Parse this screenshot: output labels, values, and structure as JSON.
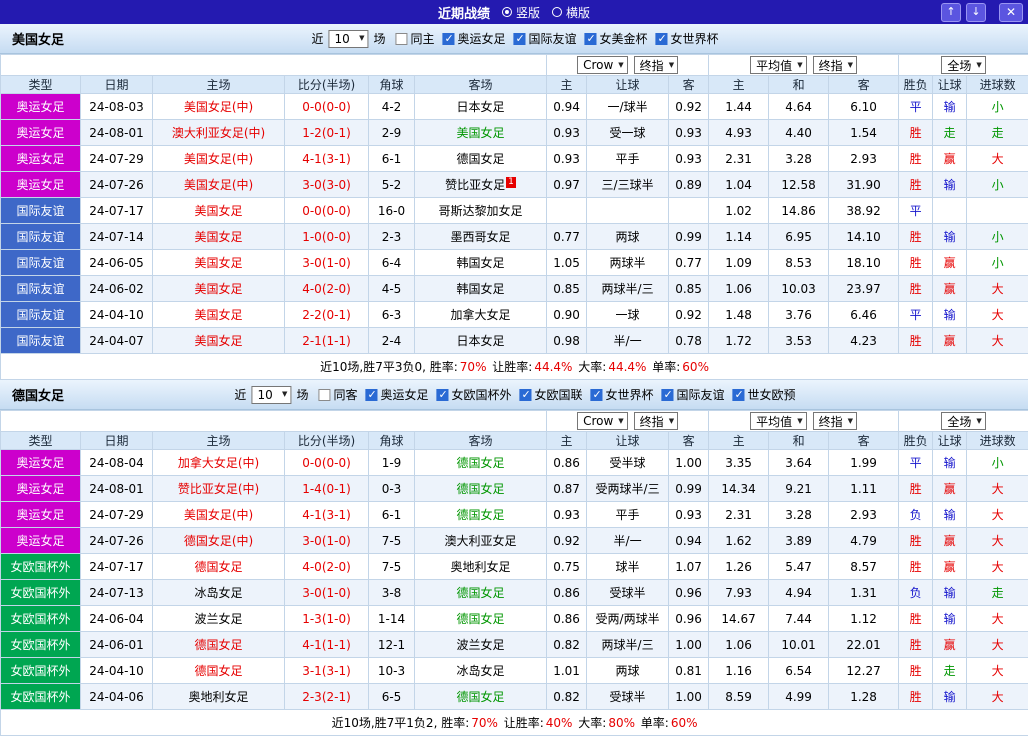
{
  "topbar": {
    "title": "近期战绩",
    "layout_options": [
      {
        "label": "竖版",
        "selected": true
      },
      {
        "label": "横版",
        "selected": false
      }
    ],
    "up_icon": "↑",
    "down_icon": "↓",
    "close_icon": "✕"
  },
  "palette": {
    "topbar_bg": "#241ab0",
    "header_bg": "#d8e8f8",
    "row_alt_bg": "#edf3fb",
    "red": "#e60000",
    "green": "#009600",
    "blue": "#1414cc"
  },
  "type_colors": {
    "奥运女足": "#cc00cc",
    "国际友谊": "#3e68c8",
    "女欧国杯外": "#00a651"
  },
  "columns": [
    "类型",
    "日期",
    "主场",
    "比分(半场)",
    "角球",
    "客场",
    "主",
    "让球",
    "客",
    "主",
    "和",
    "客",
    "胜负",
    "让球",
    "进球数"
  ],
  "sections": [
    {
      "team": "美国女足",
      "filters": {
        "near_label": "近",
        "count": "10",
        "unit_label": "场",
        "same_venue": {
          "label": "同主",
          "checked": false
        },
        "competitions": [
          {
            "label": "奥运女足",
            "checked": true
          },
          {
            "label": "国际友谊",
            "checked": true
          },
          {
            "label": "女美金杯",
            "checked": true
          },
          {
            "label": "女世界杯",
            "checked": true
          }
        ]
      },
      "selects": {
        "asian_source": "Crow",
        "asian_time": "终指",
        "euro_source": "平均值",
        "euro_time": "终指",
        "scope": "全场"
      },
      "rows": [
        {
          "type": "奥运女足",
          "date": "24-08-03",
          "home": "美国女足(中)",
          "home_color": "red",
          "score": "0-0(0-0)",
          "corner": "4-2",
          "away": "日本女足",
          "away_color": "black",
          "away_badge": "",
          "ah": [
            "0.94",
            "一/球半",
            "0.92"
          ],
          "eu": [
            "1.44",
            "4.64",
            "6.10"
          ],
          "result": "平",
          "result_color": "blue",
          "let": "输",
          "let_color": "blue",
          "goal": "小",
          "goal_color": "green"
        },
        {
          "type": "奥运女足",
          "date": "24-08-01",
          "home": "澳大利亚女足(中)",
          "home_color": "red",
          "score": "1-2(0-1)",
          "corner": "2-9",
          "away": "美国女足",
          "away_color": "green",
          "away_badge": "",
          "ah": [
            "0.93",
            "受一球",
            "0.93"
          ],
          "eu": [
            "4.93",
            "4.40",
            "1.54"
          ],
          "result": "胜",
          "result_color": "red",
          "let": "走",
          "let_color": "green",
          "goal": "走",
          "goal_color": "green"
        },
        {
          "type": "奥运女足",
          "date": "24-07-29",
          "home": "美国女足(中)",
          "home_color": "red",
          "score": "4-1(3-1)",
          "corner": "6-1",
          "away": "德国女足",
          "away_color": "black",
          "away_badge": "",
          "ah": [
            "0.93",
            "平手",
            "0.93"
          ],
          "eu": [
            "2.31",
            "3.28",
            "2.93"
          ],
          "result": "胜",
          "result_color": "red",
          "let": "赢",
          "let_color": "red",
          "goal": "大",
          "goal_color": "red"
        },
        {
          "type": "奥运女足",
          "date": "24-07-26",
          "home": "美国女足(中)",
          "home_color": "red",
          "score": "3-0(3-0)",
          "corner": "5-2",
          "away": "赞比亚女足",
          "away_color": "black",
          "away_badge": "1",
          "ah": [
            "0.97",
            "三/三球半",
            "0.89"
          ],
          "eu": [
            "1.04",
            "12.58",
            "31.90"
          ],
          "result": "胜",
          "result_color": "red",
          "let": "输",
          "let_color": "blue",
          "goal": "小",
          "goal_color": "green"
        },
        {
          "type": "国际友谊",
          "date": "24-07-17",
          "home": "美国女足",
          "home_color": "red",
          "score": "0-0(0-0)",
          "corner": "16-0",
          "away": "哥斯达黎加女足",
          "away_color": "black",
          "away_badge": "",
          "ah": [
            "",
            "",
            ""
          ],
          "eu": [
            "1.02",
            "14.86",
            "38.92"
          ],
          "result": "平",
          "result_color": "blue",
          "let": "",
          "let_color": "black",
          "goal": "",
          "goal_color": "black"
        },
        {
          "type": "国际友谊",
          "date": "24-07-14",
          "home": "美国女足",
          "home_color": "red",
          "score": "1-0(0-0)",
          "corner": "2-3",
          "away": "墨西哥女足",
          "away_color": "black",
          "away_badge": "",
          "ah": [
            "0.77",
            "两球",
            "0.99"
          ],
          "eu": [
            "1.14",
            "6.95",
            "14.10"
          ],
          "result": "胜",
          "result_color": "red",
          "let": "输",
          "let_color": "blue",
          "goal": "小",
          "goal_color": "green"
        },
        {
          "type": "国际友谊",
          "date": "24-06-05",
          "home": "美国女足",
          "home_color": "red",
          "score": "3-0(1-0)",
          "corner": "6-4",
          "away": "韩国女足",
          "away_color": "black",
          "away_badge": "",
          "ah": [
            "1.05",
            "两球半",
            "0.77"
          ],
          "eu": [
            "1.09",
            "8.53",
            "18.10"
          ],
          "result": "胜",
          "result_color": "red",
          "let": "赢",
          "let_color": "red",
          "goal": "小",
          "goal_color": "green"
        },
        {
          "type": "国际友谊",
          "date": "24-06-02",
          "home": "美国女足",
          "home_color": "red",
          "score": "4-0(2-0)",
          "corner": "4-5",
          "away": "韩国女足",
          "away_color": "black",
          "away_badge": "",
          "ah": [
            "0.85",
            "两球半/三",
            "0.85"
          ],
          "eu": [
            "1.06",
            "10.03",
            "23.97"
          ],
          "result": "胜",
          "result_color": "red",
          "let": "赢",
          "let_color": "red",
          "goal": "大",
          "goal_color": "red"
        },
        {
          "type": "国际友谊",
          "date": "24-04-10",
          "home": "美国女足",
          "home_color": "red",
          "score": "2-2(0-1)",
          "corner": "6-3",
          "away": "加拿大女足",
          "away_color": "black",
          "away_badge": "",
          "ah": [
            "0.90",
            "一球",
            "0.92"
          ],
          "eu": [
            "1.48",
            "3.76",
            "6.46"
          ],
          "result": "平",
          "result_color": "blue",
          "let": "输",
          "let_color": "blue",
          "goal": "大",
          "goal_color": "red"
        },
        {
          "type": "国际友谊",
          "date": "24-04-07",
          "home": "美国女足",
          "home_color": "red",
          "score": "2-1(1-1)",
          "corner": "2-4",
          "away": "日本女足",
          "away_color": "black",
          "away_badge": "",
          "ah": [
            "0.98",
            "半/一",
            "0.78"
          ],
          "eu": [
            "1.72",
            "3.53",
            "4.23"
          ],
          "result": "胜",
          "result_color": "red",
          "let": "赢",
          "let_color": "red",
          "goal": "大",
          "goal_color": "red"
        }
      ],
      "summary": [
        {
          "text": "近10场,胜7平3负0, 胜率:",
          "color": "black"
        },
        {
          "text": "70%",
          "color": "red"
        },
        {
          "text": " 让胜率:",
          "color": "black"
        },
        {
          "text": "44.4%",
          "color": "red"
        },
        {
          "text": " 大率:",
          "color": "black"
        },
        {
          "text": "44.4%",
          "color": "red"
        },
        {
          "text": " 单率:",
          "color": "black"
        },
        {
          "text": "60%",
          "color": "red"
        }
      ]
    },
    {
      "team": "德国女足",
      "filters": {
        "near_label": "近",
        "count": "10",
        "unit_label": "场",
        "same_venue": {
          "label": "同客",
          "checked": false
        },
        "competitions": [
          {
            "label": "奥运女足",
            "checked": true
          },
          {
            "label": "女欧国杯外",
            "checked": true
          },
          {
            "label": "女欧国联",
            "checked": true
          },
          {
            "label": "女世界杯",
            "checked": true
          },
          {
            "label": "国际友谊",
            "checked": true
          },
          {
            "label": "世女欧预",
            "checked": true
          }
        ]
      },
      "selects": {
        "asian_source": "Crow",
        "asian_time": "终指",
        "euro_source": "平均值",
        "euro_time": "终指",
        "scope": "全场"
      },
      "rows": [
        {
          "type": "奥运女足",
          "date": "24-08-04",
          "home": "加拿大女足(中)",
          "home_color": "red",
          "score": "0-0(0-0)",
          "corner": "1-9",
          "away": "德国女足",
          "away_color": "green",
          "away_badge": "",
          "ah": [
            "0.86",
            "受半球",
            "1.00"
          ],
          "eu": [
            "3.35",
            "3.64",
            "1.99"
          ],
          "result": "平",
          "result_color": "blue",
          "let": "输",
          "let_color": "blue",
          "goal": "小",
          "goal_color": "green"
        },
        {
          "type": "奥运女足",
          "date": "24-08-01",
          "home": "赞比亚女足(中)",
          "home_color": "red",
          "score": "1-4(0-1)",
          "corner": "0-3",
          "away": "德国女足",
          "away_color": "green",
          "away_badge": "",
          "ah": [
            "0.87",
            "受两球半/三",
            "0.99"
          ],
          "eu": [
            "14.34",
            "9.21",
            "1.11"
          ],
          "result": "胜",
          "result_color": "red",
          "let": "赢",
          "let_color": "red",
          "goal": "大",
          "goal_color": "red"
        },
        {
          "type": "奥运女足",
          "date": "24-07-29",
          "home": "美国女足(中)",
          "home_color": "red",
          "score": "4-1(3-1)",
          "corner": "6-1",
          "away": "德国女足",
          "away_color": "green",
          "away_badge": "",
          "ah": [
            "0.93",
            "平手",
            "0.93"
          ],
          "eu": [
            "2.31",
            "3.28",
            "2.93"
          ],
          "result": "负",
          "result_color": "blue",
          "let": "输",
          "let_color": "blue",
          "goal": "大",
          "goal_color": "red"
        },
        {
          "type": "奥运女足",
          "date": "24-07-26",
          "home": "德国女足(中)",
          "home_color": "red",
          "score": "3-0(1-0)",
          "corner": "7-5",
          "away": "澳大利亚女足",
          "away_color": "black",
          "away_badge": "",
          "ah": [
            "0.92",
            "半/一",
            "0.94"
          ],
          "eu": [
            "1.62",
            "3.89",
            "4.79"
          ],
          "result": "胜",
          "result_color": "red",
          "let": "赢",
          "let_color": "red",
          "goal": "大",
          "goal_color": "red"
        },
        {
          "type": "女欧国杯外",
          "date": "24-07-17",
          "home": "德国女足",
          "home_color": "red",
          "score": "4-0(2-0)",
          "corner": "7-5",
          "away": "奥地利女足",
          "away_color": "black",
          "away_badge": "",
          "ah": [
            "0.75",
            "球半",
            "1.07"
          ],
          "eu": [
            "1.26",
            "5.47",
            "8.57"
          ],
          "result": "胜",
          "result_color": "red",
          "let": "赢",
          "let_color": "red",
          "goal": "大",
          "goal_color": "red"
        },
        {
          "type": "女欧国杯外",
          "date": "24-07-13",
          "home": "冰岛女足",
          "home_color": "black",
          "score": "3-0(1-0)",
          "corner": "3-8",
          "away": "德国女足",
          "away_color": "green",
          "away_badge": "",
          "ah": [
            "0.86",
            "受球半",
            "0.96"
          ],
          "eu": [
            "7.93",
            "4.94",
            "1.31"
          ],
          "result": "负",
          "result_color": "blue",
          "let": "输",
          "let_color": "blue",
          "goal": "走",
          "goal_color": "green"
        },
        {
          "type": "女欧国杯外",
          "date": "24-06-04",
          "home": "波兰女足",
          "home_color": "black",
          "score": "1-3(1-0)",
          "corner": "1-14",
          "away": "德国女足",
          "away_color": "green",
          "away_badge": "",
          "ah": [
            "0.86",
            "受两/两球半",
            "0.96"
          ],
          "eu": [
            "14.67",
            "7.44",
            "1.12"
          ],
          "result": "胜",
          "result_color": "red",
          "let": "输",
          "let_color": "blue",
          "goal": "大",
          "goal_color": "red"
        },
        {
          "type": "女欧国杯外",
          "date": "24-06-01",
          "home": "德国女足",
          "home_color": "red",
          "score": "4-1(1-1)",
          "corner": "12-1",
          "away": "波兰女足",
          "away_color": "black",
          "away_badge": "",
          "ah": [
            "0.82",
            "两球半/三",
            "1.00"
          ],
          "eu": [
            "1.06",
            "10.01",
            "22.01"
          ],
          "result": "胜",
          "result_color": "red",
          "let": "赢",
          "let_color": "red",
          "goal": "大",
          "goal_color": "red"
        },
        {
          "type": "女欧国杯外",
          "date": "24-04-10",
          "home": "德国女足",
          "home_color": "red",
          "score": "3-1(3-1)",
          "corner": "10-3",
          "away": "冰岛女足",
          "away_color": "black",
          "away_badge": "",
          "ah": [
            "1.01",
            "两球",
            "0.81"
          ],
          "eu": [
            "1.16",
            "6.54",
            "12.27"
          ],
          "result": "胜",
          "result_color": "red",
          "let": "走",
          "let_color": "green",
          "goal": "大",
          "goal_color": "red"
        },
        {
          "type": "女欧国杯外",
          "date": "24-04-06",
          "home": "奥地利女足",
          "home_color": "black",
          "score": "2-3(2-1)",
          "corner": "6-5",
          "away": "德国女足",
          "away_color": "green",
          "away_badge": "",
          "ah": [
            "0.82",
            "受球半",
            "1.00"
          ],
          "eu": [
            "8.59",
            "4.99",
            "1.28"
          ],
          "result": "胜",
          "result_color": "red",
          "let": "输",
          "let_color": "blue",
          "goal": "大",
          "goal_color": "red"
        }
      ],
      "summary": [
        {
          "text": "近10场,胜7平1负2, 胜率:",
          "color": "black"
        },
        {
          "text": "70%",
          "color": "red"
        },
        {
          "text": " 让胜率:",
          "color": "black"
        },
        {
          "text": "40%",
          "color": "red"
        },
        {
          "text": " 大率:",
          "color": "black"
        },
        {
          "text": "80%",
          "color": "red"
        },
        {
          "text": " 单率:",
          "color": "black"
        },
        {
          "text": "60%",
          "color": "red"
        }
      ]
    }
  ]
}
